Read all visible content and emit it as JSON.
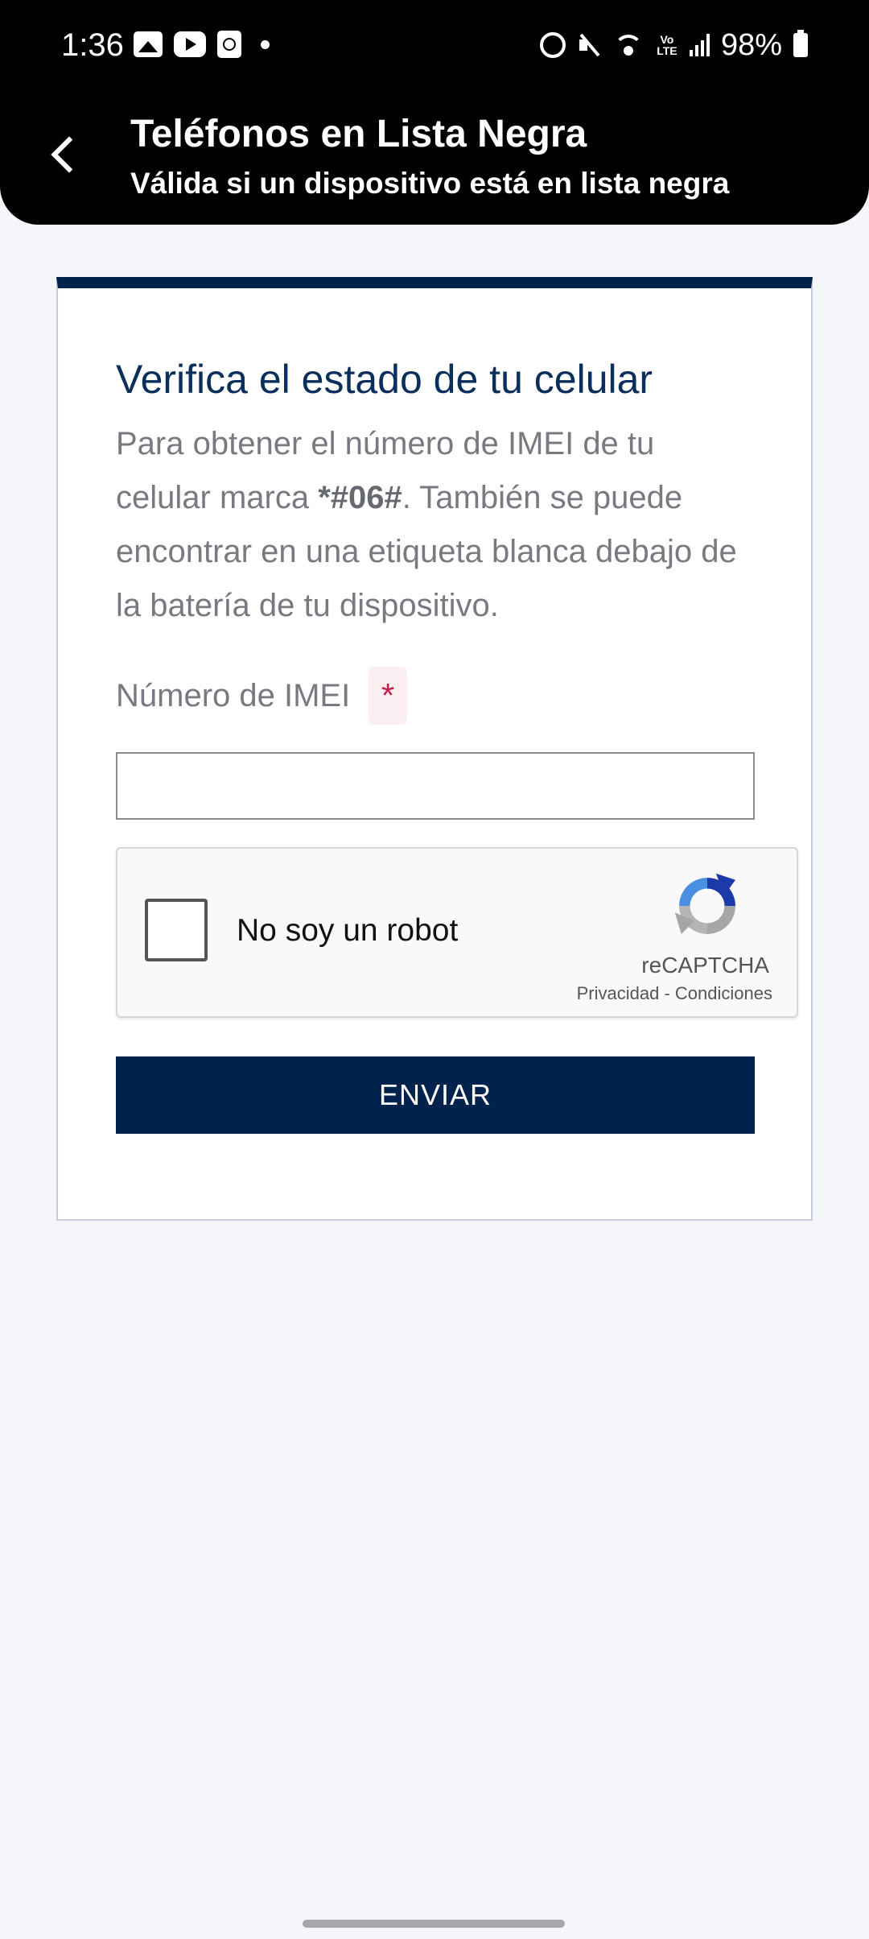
{
  "status_bar": {
    "time": "1:36",
    "battery": "98%",
    "left_icons": [
      "gallery-icon",
      "youtube-icon",
      "clock-app-icon",
      "notification-dot-icon"
    ],
    "right_icons": [
      "alarm-icon",
      "mute-icon",
      "wifi-icon",
      "volte-icon",
      "signal-icon",
      "battery-icon"
    ],
    "volte_label": "Vo LTE"
  },
  "header": {
    "title": "Teléfonos en Lista Negra",
    "subtitle": "Válida si un dispositivo está en lista negra",
    "back_icon": "back-arrow-icon"
  },
  "card": {
    "title": "Verifica el estado de tu celular",
    "description_before": "Para obtener el número de IMEI de tu celular marca ",
    "description_code": "*#06#",
    "description_after": ". También se puede encontrar en una etiqueta blanca debajo de la batería de tu dispositivo.",
    "imei_label": "Número de IMEI",
    "required_mark": "*",
    "imei_value": "",
    "recaptcha": {
      "label": "No soy un robot",
      "brand": "reCAPTCHA",
      "privacy": "Privacidad",
      "separator": "-",
      "terms": "Condiciones"
    },
    "submit_label": "ENVIAR"
  },
  "colors": {
    "header_bg": "#000000",
    "accent_navy": "#00234d",
    "page_bg": "#f5f6fa",
    "required_red": "#c71a4b"
  }
}
